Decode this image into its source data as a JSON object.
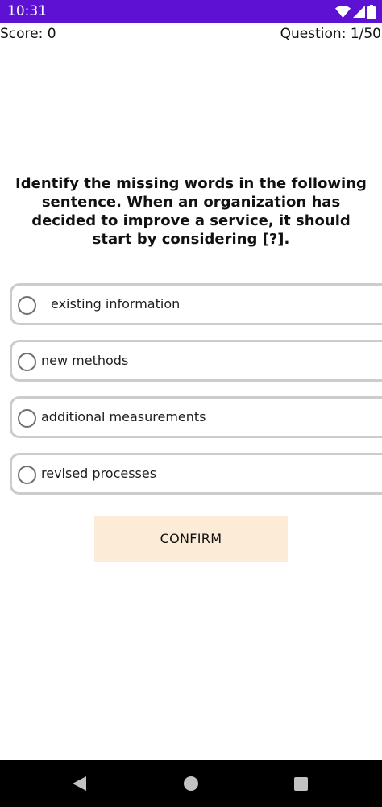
{
  "status_bar": {
    "time": "10:31",
    "icons": [
      "wifi-icon",
      "cellular-signal-icon",
      "battery-icon"
    ],
    "color": "#5d11d2"
  },
  "header": {
    "score": "Score: 0",
    "question_counter": "Question: 1/50"
  },
  "question": {
    "text": "Identify the missing words in the following sentence. When an organization has decided to improve a service, it should start by considering [?]."
  },
  "options": [
    {
      "label": "existing information",
      "selected": false
    },
    {
      "label": "new methods",
      "selected": false
    },
    {
      "label": "additional measurements",
      "selected": false
    },
    {
      "label": "revised processes",
      "selected": false
    }
  ],
  "confirm": {
    "label": "CONFIRM",
    "color": "#fcebd7"
  },
  "nav_bar": {
    "icons": [
      "back-icon",
      "home-icon",
      "recents-icon"
    ]
  }
}
